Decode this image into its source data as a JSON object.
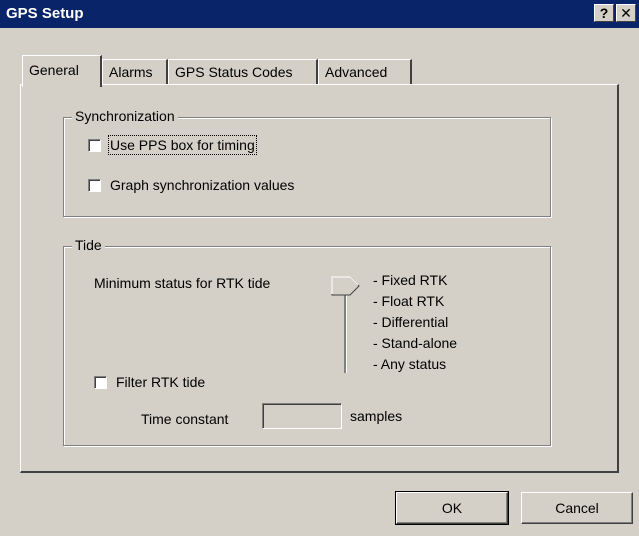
{
  "window": {
    "title": "GPS Setup",
    "help_label": "?",
    "close_label": "✕"
  },
  "tabs": [
    {
      "label": "General",
      "active": true
    },
    {
      "label": "Alarms",
      "active": false
    },
    {
      "label": "GPS Status Codes",
      "active": false
    },
    {
      "label": "Advanced",
      "active": false
    }
  ],
  "synchronization": {
    "legend": "Synchronization",
    "use_pps_label": "Use PPS box for timing",
    "use_pps_checked": false,
    "graph_sync_label": "Graph synchronization values",
    "graph_sync_checked": false
  },
  "tide": {
    "legend": "Tide",
    "min_status_label": "Minimum status for RTK tide",
    "rtk_levels": [
      "- Fixed RTK",
      "- Float RTK",
      "- Differential",
      "- Stand-alone",
      "- Any status"
    ],
    "selected_level": "- Fixed RTK",
    "filter_label": "Filter RTK tide",
    "filter_checked": false,
    "time_constant_label": "Time constant",
    "time_constant_value": "",
    "samples_label": "samples"
  },
  "buttons": {
    "ok": "OK",
    "cancel": "Cancel"
  }
}
